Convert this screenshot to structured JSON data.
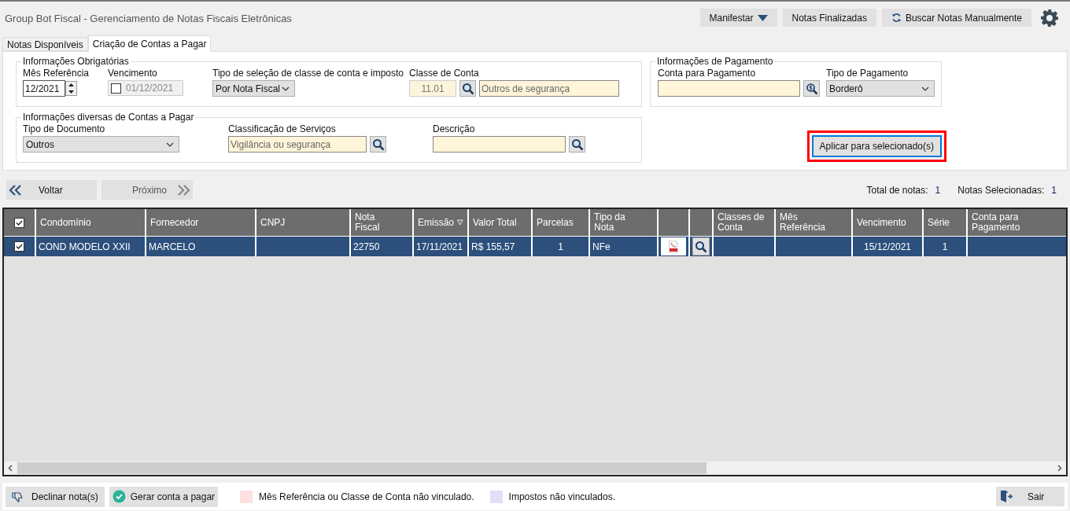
{
  "window": {
    "title": "Group Bot Fiscal - Gerenciamento de Notas Fiscais Eletrônicas"
  },
  "toolbar": [
    {
      "label": "Manifestar",
      "kind": "dropdown"
    },
    {
      "label": "Notas Finalizadas",
      "kind": "plain"
    },
    {
      "label": "Buscar Notas Manualmente",
      "kind": "refresh"
    }
  ],
  "tabs": [
    {
      "label": "Notas Disponíveis",
      "selected": false
    },
    {
      "label": "Criação de Contas a Pagar",
      "selected": true
    }
  ],
  "obrigatorias": {
    "title": "Informações Obrigatórias",
    "mes_referencia": {
      "label": "Mês Referência",
      "value": "12/2021"
    },
    "vencimento": {
      "label": "Vencimento",
      "checked": false,
      "value": "01/12/2021"
    },
    "tipo_selecao": {
      "label": "Tipo de seleção de classe de conta e imposto",
      "value": "Por Nota Fiscal"
    },
    "classe_conta": {
      "label": "Classe de Conta",
      "code": "11.01",
      "name": "Outros de segurança"
    }
  },
  "diversas": {
    "title": "Informações diversas de Contas a Pagar",
    "tipo_documento": {
      "label": "Tipo de Documento",
      "value": "Outros"
    },
    "classificacao": {
      "label": "Classificação de Serviços",
      "value": "Vigilância ou segurança"
    },
    "descricao": {
      "label": "Descrição"
    }
  },
  "pagamento": {
    "title": "Informações de Pagamento",
    "conta": {
      "label": "Conta para Pagamento"
    },
    "tipo": {
      "label": "Tipo de Pagamento",
      "value": "Borderô"
    }
  },
  "apply_button": {
    "label": "Aplicar para selecionado(s)",
    "highlighted": true
  },
  "nav": {
    "back": {
      "label": "Voltar"
    },
    "next": {
      "label": "Próximo"
    }
  },
  "totals": [
    {
      "label": "Total de notas:",
      "value": "1"
    },
    {
      "label": "Notas Selecionadas:",
      "value": "1"
    }
  ],
  "table": {
    "all_checked": true,
    "columns": [
      {
        "kind": "check"
      },
      {
        "label": "Condomínio"
      },
      {
        "label": "Fornecedor"
      },
      {
        "label": "CNPJ"
      },
      {
        "label": "Nota Fiscal"
      },
      {
        "label": "Emissão",
        "sorted": true
      },
      {
        "label": "Valor Total"
      },
      {
        "label": "Parcelas"
      },
      {
        "label": "Tipo da Nota"
      },
      {
        "kind": "pdf"
      },
      {
        "kind": "view"
      },
      {
        "label": "Classes de Conta"
      },
      {
        "label": "Mês Referência"
      },
      {
        "label": "Vencimento"
      },
      {
        "label": "Série"
      },
      {
        "label": "Conta para Pagamento"
      }
    ],
    "rows": [
      {
        "selected": true,
        "checked": true,
        "condominio": "COND MODELO XXII",
        "fornecedor": "MARCELO",
        "nota_fiscal": "22750",
        "emissao": "17/11/2021",
        "valor_total": "R$ 155,57",
        "parcelas": "1",
        "tipo_nota": "NFe",
        "vencimento": "15/12/2021",
        "serie": "1"
      }
    ]
  },
  "footer": {
    "decline": {
      "label": "Declinar nota(s)"
    },
    "generate": {
      "label": "Gerar conta a pagar"
    },
    "legend": [
      {
        "label": "Mês Referência ou Classe de Conta não vinculado.",
        "color": "#fde0e0"
      },
      {
        "label": "Impostos não vinculados.",
        "color": "#e0e0f8"
      }
    ],
    "exit": {
      "label": "Sair"
    }
  }
}
